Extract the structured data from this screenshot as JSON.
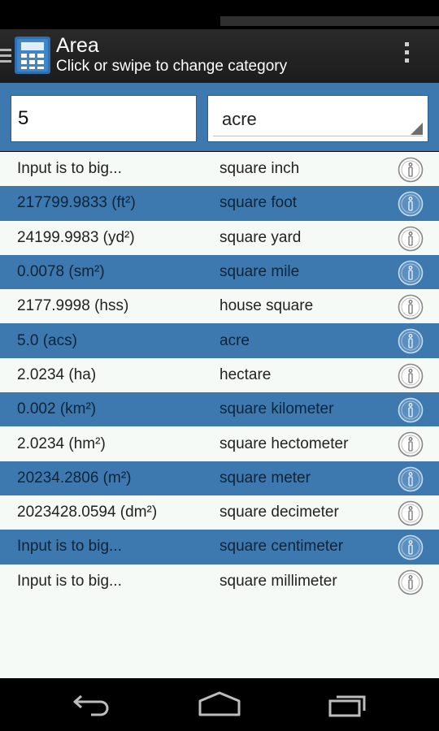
{
  "app": {
    "title": "Area",
    "subtitle": "Click or swipe to change category"
  },
  "input": {
    "value": "5",
    "selected_unit": "acre"
  },
  "rows": [
    {
      "result": "Input is to big...",
      "unit": "square inch"
    },
    {
      "result": "217799.9833 (ft²)",
      "unit": "square foot"
    },
    {
      "result": "24199.9983 (yd²)",
      "unit": "square yard"
    },
    {
      "result": "0.0078 (sm²)",
      "unit": "square mile"
    },
    {
      "result": "2177.9998 (hss)",
      "unit": "house square"
    },
    {
      "result": "5.0 (acs)",
      "unit": "acre"
    },
    {
      "result": "2.0234 (ha)",
      "unit": "hectare"
    },
    {
      "result": "0.002 (km²)",
      "unit": "square kilometer"
    },
    {
      "result": "2.0234 (hm²)",
      "unit": "square hectometer"
    },
    {
      "result": "20234.2806 (m²)",
      "unit": "square meter"
    },
    {
      "result": "2023428.0594 (dm²)",
      "unit": "square decimeter"
    },
    {
      "result": "Input is to big...",
      "unit": "square centimeter"
    },
    {
      "result": "Input is to big...",
      "unit": "square millimeter"
    }
  ],
  "icons": {
    "drawer": "menu-icon",
    "app": "calculator-icon",
    "overflow": "more-vert-icon",
    "info": "info-icon",
    "back": "back-icon",
    "home": "home-icon",
    "recents": "recents-icon"
  },
  "colors": {
    "accent": "#3d79ae",
    "row_light": "#f6faf7",
    "action_bar": "#1f1f1f"
  }
}
